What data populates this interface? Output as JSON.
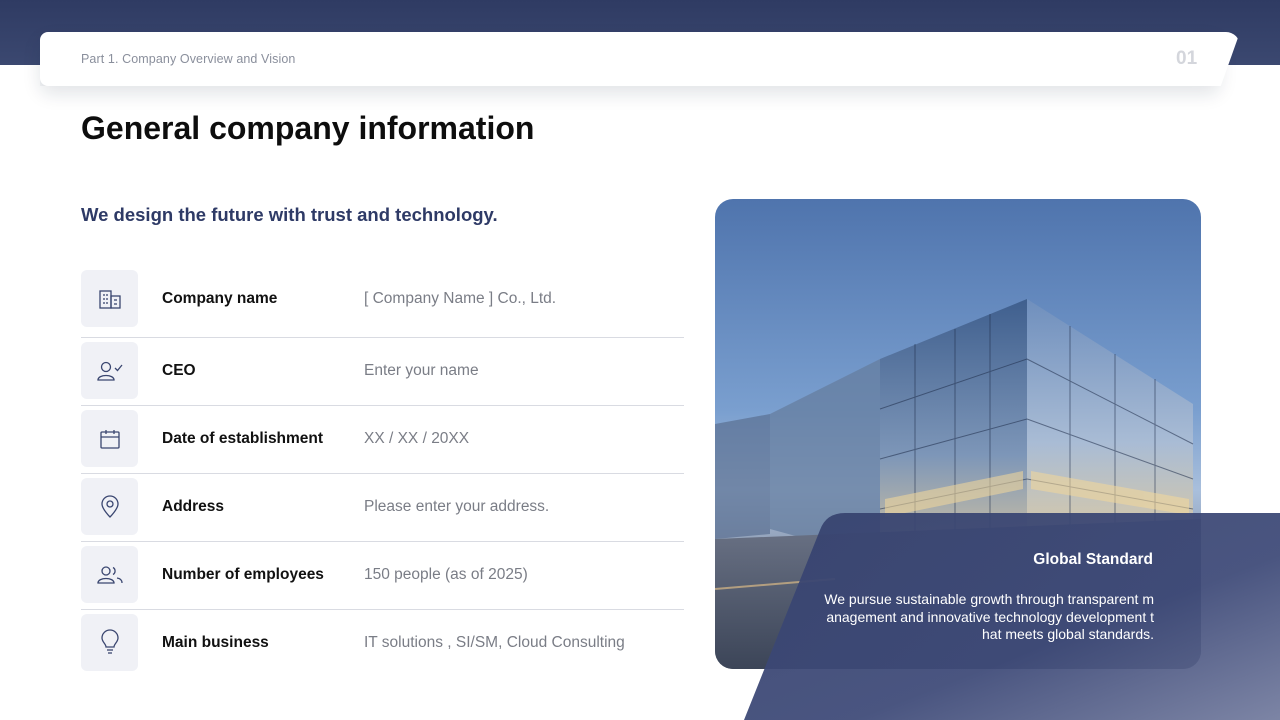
{
  "header": {
    "breadcrumb": "Part 1. Company Overview and Vision",
    "page_number": "01"
  },
  "title": "General company information",
  "tagline": "We design the future with trust and technology.",
  "info_rows": [
    {
      "icon": "building-icon",
      "label": "Company name",
      "value": "[ Company Name ] Co., Ltd."
    },
    {
      "icon": "person-check-icon",
      "label": "CEO",
      "value": "Enter your name"
    },
    {
      "icon": "calendar-icon",
      "label": "Date of establishment",
      "value": "XX / XX / 20XX"
    },
    {
      "icon": "location-pin-icon",
      "label": "Address",
      "value": "Please enter your address."
    },
    {
      "icon": "people-icon",
      "label": "Number of employees",
      "value": "150 people (as of 2025)"
    },
    {
      "icon": "lightbulb-icon",
      "label": "Main business",
      "value": "IT solutions , SI/SM, Cloud Consulting"
    }
  ],
  "feature": {
    "caption_title": "Global Standard",
    "caption_text": "We pursue sustainable growth through transparent management and innovative technology development that meets global standards."
  },
  "colors": {
    "navy": "#2e3a66",
    "icon_bg": "#f0f1f6",
    "divider": "#d9dbe2",
    "value_text": "#7a7d86"
  }
}
